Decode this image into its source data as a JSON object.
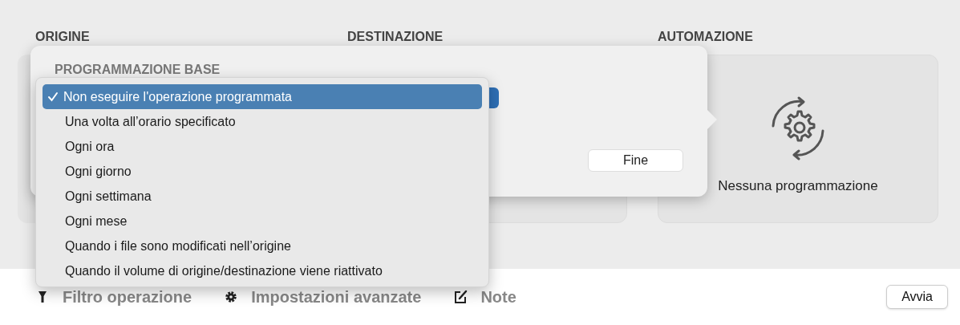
{
  "columns": [
    "ORIGINE",
    "DESTINAZIONE",
    "AUTOMAZIONE"
  ],
  "automation": {
    "status": "Nessuna programmazione"
  },
  "popover": {
    "section_title": "PROGRAMMAZIONE BASE",
    "done_button": "Fine",
    "menu": [
      {
        "label": "Non eseguire l'operazione programmata",
        "selected": true
      },
      {
        "label": "Una volta all’orario specificato",
        "selected": false
      },
      {
        "label": "Ogni ora",
        "selected": false
      },
      {
        "label": "Ogni giorno",
        "selected": false
      },
      {
        "label": "Ogni settimana",
        "selected": false
      },
      {
        "label": "Ogni mese",
        "selected": false
      },
      {
        "label": "Quando i file sono modificati nell’origine",
        "selected": false
      },
      {
        "label": "Quando il volume di origine/destinazione viene riattivato",
        "selected": false
      }
    ]
  },
  "toolbar": [
    {
      "kind": "filter",
      "label": "Filtro operazione"
    },
    {
      "kind": "gear",
      "label": "Impostazioni avanzate"
    },
    {
      "kind": "note",
      "label": "Note"
    }
  ],
  "start_button": "Avvia"
}
